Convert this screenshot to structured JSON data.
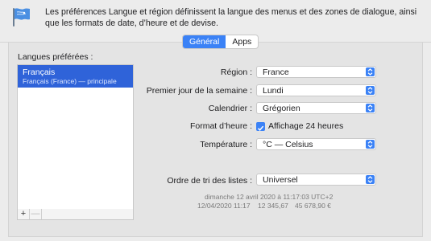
{
  "header": {
    "description": "Les préférences Langue et région définissent la langue des menus et des zones de dialogue, ainsi que les formats de date, d’heure et de devise."
  },
  "tabs": [
    {
      "label": "Général",
      "active": true
    },
    {
      "label": "Apps",
      "active": false
    }
  ],
  "languages": {
    "title": "Langues préférées :",
    "items": [
      {
        "name": "Français",
        "subtitle": "Français (France) — principale",
        "selected": true
      }
    ],
    "controls": {
      "add": "+",
      "remove": "—"
    }
  },
  "settings": {
    "region": {
      "label": "Région :",
      "value": "France"
    },
    "first_day": {
      "label": "Premier jour de la semaine :",
      "value": "Lundi"
    },
    "calendar": {
      "label": "Calendrier :",
      "value": "Grégorien"
    },
    "time_format": {
      "label": "Format d’heure :",
      "checkbox_label": "Affichage 24 heures",
      "checked": true
    },
    "temperature": {
      "label": "Température :",
      "value": "°C — Celsius"
    },
    "sort_order": {
      "label": "Ordre de tri des listes :",
      "value": "Universel"
    }
  },
  "samples": {
    "date_line": "dimanche 12 avril 2020 à 11:17:03 UTC+2",
    "short_date": "12/04/2020 11:17",
    "number": "12 345,67",
    "currency": "45 678,90 €"
  },
  "colors": {
    "accent": "#3b82f6",
    "selection": "#2f63d9",
    "window_bg": "#ececec"
  },
  "icons": {
    "header": "flag-icon",
    "select_arrow": "updown-chevron-icon",
    "checkbox": "checkmark-icon"
  }
}
